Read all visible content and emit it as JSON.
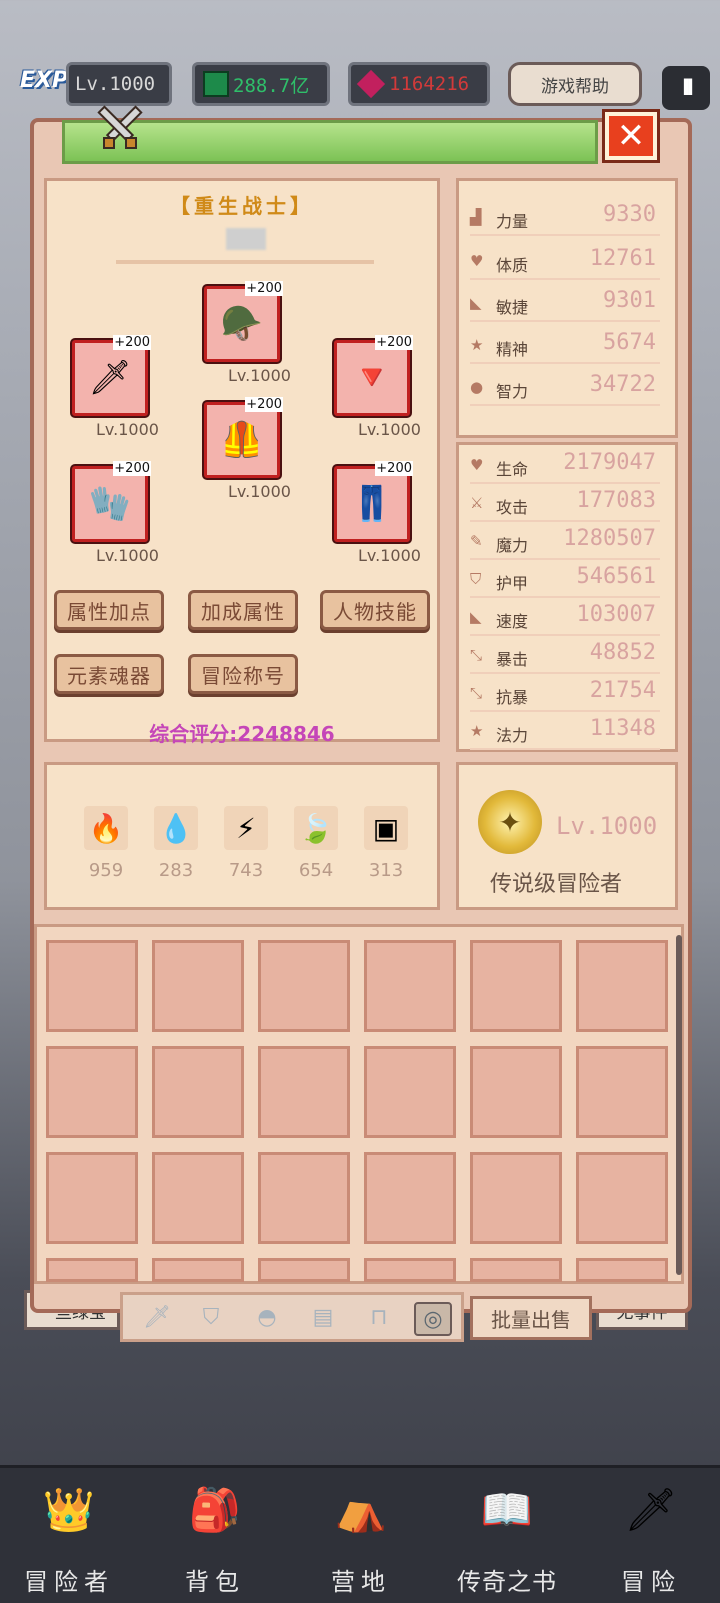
{
  "hud": {
    "exp_label": "EXP",
    "level": "Lv.1000",
    "green_currency": "288.7亿",
    "red_currency": "1164216",
    "help_button": "游戏帮助",
    "pause": "II"
  },
  "character": {
    "title": "【重生战士】",
    "score": "综合评分:2248846",
    "equipment": [
      {
        "name": "weapon-sword-icon",
        "glyph": "🗡",
        "plus": "+200",
        "level": "Lv.1000"
      },
      {
        "name": "helmet-icon",
        "glyph": "🪖",
        "plus": "+200",
        "level": "Lv.1000"
      },
      {
        "name": "amulet-icon",
        "glyph": "🔻",
        "plus": "+200",
        "level": "Lv.1000"
      },
      {
        "name": "armor-icon",
        "glyph": "🦺",
        "plus": "+200",
        "level": "Lv.1000"
      },
      {
        "name": "gloves-icon",
        "glyph": "🧤",
        "plus": "+200",
        "level": "Lv.1000"
      },
      {
        "name": "leggings-icon",
        "glyph": "👖",
        "plus": "+200",
        "level": "Lv.1000"
      }
    ],
    "buttons": [
      "属性加点",
      "加成属性",
      "人物技能",
      "元素魂器",
      "冒险称号"
    ],
    "elements": [
      {
        "name": "fire-element-icon",
        "glyph": "🔥",
        "value": "959"
      },
      {
        "name": "water-element-icon",
        "glyph": "💧",
        "value": "283"
      },
      {
        "name": "lightning-element-icon",
        "glyph": "⚡",
        "value": "743"
      },
      {
        "name": "wind-element-icon",
        "glyph": "🍃",
        "value": "654"
      },
      {
        "name": "dark-element-icon",
        "glyph": "▣",
        "value": "313"
      }
    ]
  },
  "base_stats": [
    {
      "label": "力量",
      "value": "9330",
      "icon": "▟"
    },
    {
      "label": "体质",
      "value": "12761",
      "icon": "♥"
    },
    {
      "label": "敏捷",
      "value": "9301",
      "icon": "◣"
    },
    {
      "label": "精神",
      "value": "5674",
      "icon": "★"
    },
    {
      "label": "智力",
      "value": "34722",
      "icon": "●"
    }
  ],
  "combat_stats": [
    {
      "label": "生命",
      "value": "2179047",
      "icon": "♥"
    },
    {
      "label": "攻击",
      "value": "177083",
      "icon": "⚔"
    },
    {
      "label": "魔力",
      "value": "1280507",
      "icon": "✎"
    },
    {
      "label": "护甲",
      "value": "546561",
      "icon": "⛉"
    },
    {
      "label": "速度",
      "value": "103007",
      "icon": "◣"
    },
    {
      "label": "暴击",
      "value": "48852",
      "icon": "⤡"
    },
    {
      "label": "抗暴",
      "value": "21754",
      "icon": "⤡"
    },
    {
      "label": "法力",
      "value": "11348",
      "icon": "★"
    }
  ],
  "rank": {
    "level": "Lv.1000",
    "title": "传说级冒险者"
  },
  "inventory": {
    "sell_button": "批量出售",
    "filters": [
      {
        "name": "filter-weapon-icon",
        "glyph": "🗡"
      },
      {
        "name": "filter-shield-icon",
        "glyph": "⛉"
      },
      {
        "name": "filter-helmet-icon",
        "glyph": "◓"
      },
      {
        "name": "filter-armor-icon",
        "glyph": "▤"
      },
      {
        "name": "filter-legs-icon",
        "glyph": "⊓"
      },
      {
        "name": "filter-ring-icon",
        "glyph": "◎"
      }
    ]
  },
  "background": {
    "left_chip": "一些绿宝",
    "right_chip": "无事件"
  },
  "nav": [
    {
      "label": "冒险者",
      "glyph": "👑",
      "name": "nav-adventurer"
    },
    {
      "label": "背包",
      "glyph": "🎒",
      "name": "nav-backpack"
    },
    {
      "label": "营地",
      "glyph": "⛺",
      "name": "nav-camp"
    },
    {
      "label": "传奇之书",
      "glyph": "📖",
      "name": "nav-legend-book"
    },
    {
      "label": "冒险",
      "glyph": "🗡",
      "name": "nav-adventure"
    }
  ],
  "colors": {
    "panel_bg": "#e9c7b4",
    "card_bg": "#f7e2c8",
    "title_gold": "#d08a18",
    "score_purple": "#c546b8",
    "stat_value": "#d8a3a0",
    "close_red": "#e8401e"
  }
}
